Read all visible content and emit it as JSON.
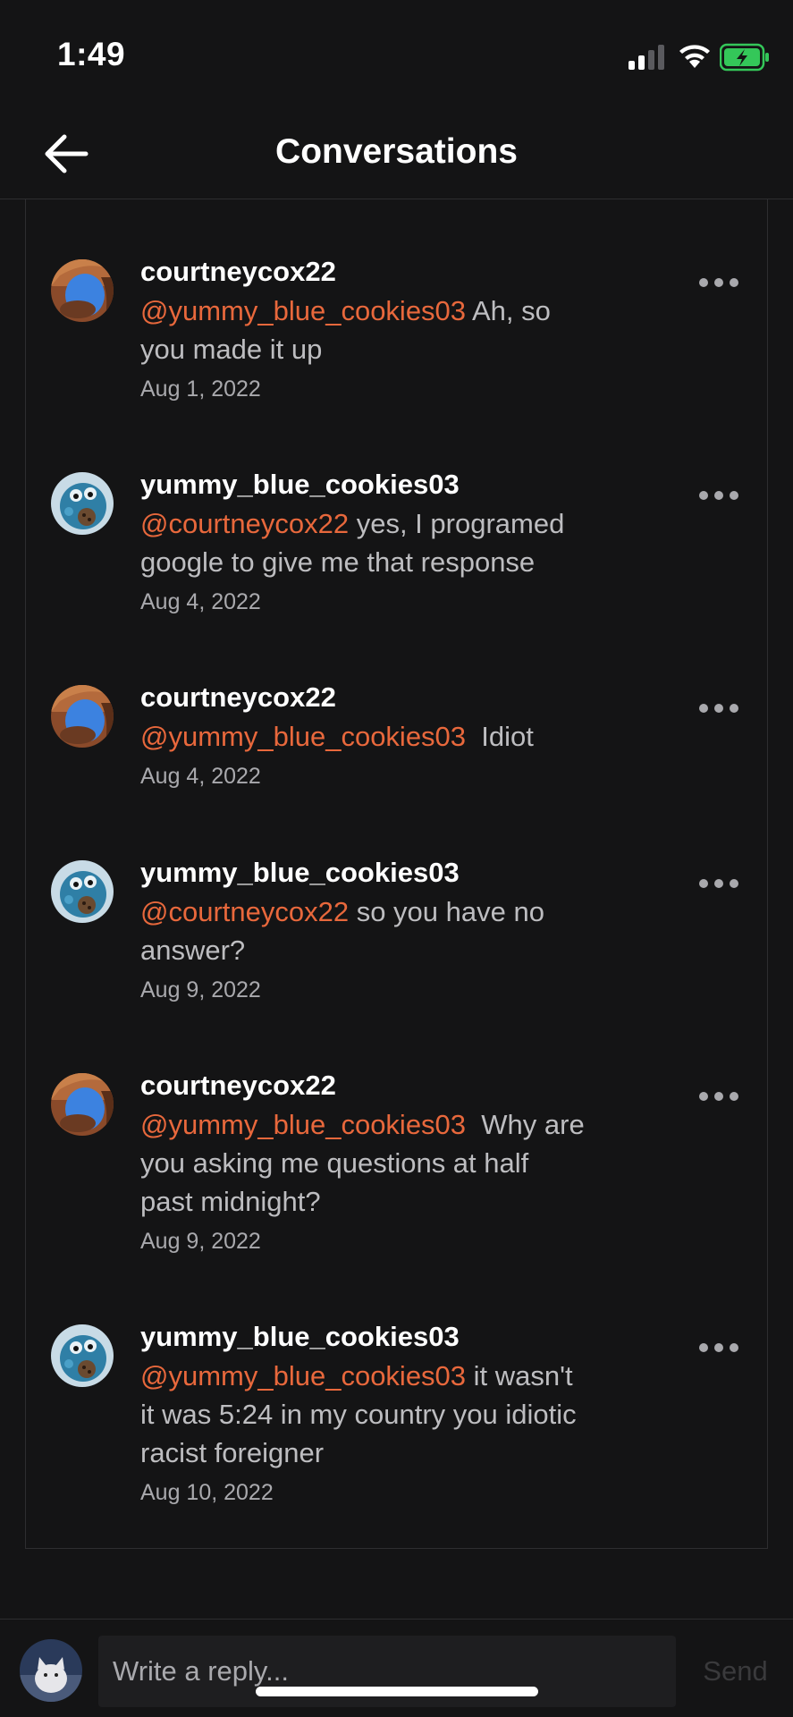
{
  "status_bar": {
    "time": "1:49",
    "icons": [
      "cellular-signal-icon",
      "wifi-icon",
      "battery-charging-icon"
    ],
    "battery_color": "#34c759"
  },
  "header": {
    "title": "Conversations",
    "back_icon": "arrow-left-icon"
  },
  "colors": {
    "background": "#141415",
    "mention": "#e8683c",
    "body_text": "#bdbdc0",
    "secondary_text": "#a9a9ad"
  },
  "comments": [
    {
      "user": "courtneycox22",
      "mention": "@yummy_blue_cookies03",
      "text": " Ah, so you made it up",
      "date": "Aug 1, 2022",
      "avatar": "arch-avatar"
    },
    {
      "user": "yummy_blue_cookies03",
      "mention": "@courtneycox22",
      "text": " yes, I programed google to give me that response",
      "date": "Aug 4, 2022",
      "avatar": "cookie-monster-avatar"
    },
    {
      "user": "courtneycox22",
      "mention": "@yummy_blue_cookies03",
      "text": "  Idiot",
      "date": "Aug 4, 2022",
      "avatar": "arch-avatar"
    },
    {
      "user": "yummy_blue_cookies03",
      "mention": "@courtneycox22",
      "text": " so you have no answer?",
      "date": "Aug 9, 2022",
      "avatar": "cookie-monster-avatar"
    },
    {
      "user": "courtneycox22",
      "mention": "@yummy_blue_cookies03",
      "text": "  Why are you asking me questions at half past midnight?",
      "date": "Aug 9, 2022",
      "avatar": "arch-avatar"
    },
    {
      "user": "yummy_blue_cookies03",
      "mention": "@yummy_blue_cookies03",
      "text": " it wasn't it was 5:24 in my country you idiotic racist foreigner",
      "date": "Aug 10, 2022",
      "avatar": "cookie-monster-avatar"
    }
  ],
  "reply": {
    "placeholder": "Write a reply...",
    "send_label": "Send",
    "avatar": "cat-avatar"
  }
}
